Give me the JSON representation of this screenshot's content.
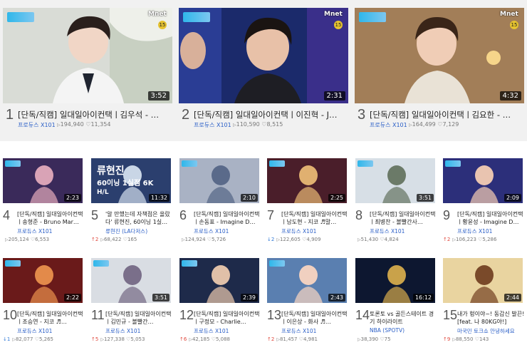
{
  "top": [
    {
      "rank": "1",
      "title": "[단독/직캠] 일대일아이컨택ㅣ김우석 - …",
      "channel": "프로듀스 X101",
      "views": "194,940",
      "likes": "11,354",
      "duration": "3:52",
      "channel_logo": "Mnet"
    },
    {
      "rank": "2",
      "title": "[단독/직캠] 일대일아이컨택ㅣ이진혁 - J…",
      "channel": "프로듀스 X101",
      "views": "110,590",
      "likes": "8,515",
      "duration": "2:31",
      "channel_logo": "Mnet"
    },
    {
      "rank": "3",
      "title": "[단독/직캠] 일대일아이컨택ㅣ김요한 - …",
      "channel": "프로듀스 X101",
      "views": "164,499",
      "likes": "7,129",
      "duration": "4:32",
      "channel_logo": "Mnet"
    }
  ],
  "row1": [
    {
      "rank": "4",
      "title": "[단독/직캠] 일대일아이컨택ㅣ송형준 - Bruno Mar…",
      "channel": "프로듀스 X101",
      "change": "",
      "change_dir": "",
      "views": "205,124",
      "likes": "6,553",
      "duration": "2:23"
    },
    {
      "rank": "5",
      "title": "'알 만했는데 자책점은 올랐다' 류현진, 60이닝 1실…",
      "channel": "류현진 (LA다저스)",
      "change": "↑2",
      "change_dir": "up",
      "views": "68,422",
      "likes": "165",
      "duration": "11:32",
      "overlay_text": "류현진",
      "overlay_sub": "60이닝 1실점 6K",
      "overlay_sub2": "H/L"
    },
    {
      "rank": "6",
      "title": "[단독/직캠] 일대일아이컨택ㅣ손동표 - Imagine D…",
      "channel": "프로듀스 X101",
      "change": "",
      "change_dir": "",
      "views": "124,924",
      "likes": "5,726",
      "duration": "2:10"
    },
    {
      "rank": "7",
      "title": "[단독/직캠] 일대일아이컨택ㅣ남도현 - 지코 ♬말…",
      "channel": "프로듀스 X101",
      "change": "↓2",
      "change_dir": "down",
      "views": "122,605",
      "likes": "4,909",
      "duration": "2:25"
    },
    {
      "rank": "8",
      "title": "[단독/직캠] 일대일아이컨택ㅣ최병찬 - 볼빨간사…",
      "channel": "프로듀스 X101",
      "change": "",
      "change_dir": "",
      "views": "51,430",
      "likes": "4,824",
      "duration": "3:51"
    },
    {
      "rank": "9",
      "title": "[단독/직캠] 일대일아이컨택ㅣ황윤성 - Imagine D…",
      "channel": "프로듀스 X101",
      "change": "↑2",
      "change_dir": "up",
      "views": "106,223",
      "likes": "5,286",
      "duration": "2:09"
    }
  ],
  "row2": [
    {
      "rank": "10",
      "title": "[단독/직캠] 일대일아이컨택ㅣ조승연 - 지코 ♬…",
      "channel": "프로듀스 X101",
      "change": "↓1",
      "change_dir": "down",
      "views": "82,077",
      "likes": "5,265",
      "duration": "2:22"
    },
    {
      "rank": "11",
      "title": "[단독/직캠] 일대일아이컨택ㅣ김민규 - 볼빨간…",
      "channel": "프로듀스 X101",
      "change": "↑5",
      "change_dir": "up",
      "views": "127,338",
      "likes": "5,053",
      "duration": "3:51"
    },
    {
      "rank": "12",
      "title": "[단독/직캠] 일대일아이컨택ㅣ구정모 - Charlie…",
      "channel": "프로듀스 X101",
      "change": "↑6",
      "change_dir": "up",
      "views": "42,185",
      "likes": "5,088",
      "duration": "2:39"
    },
    {
      "rank": "13",
      "title": "[단독/직캠] 일대일아이컨택ㅣ이은상 - 화사 ♬…",
      "channel": "프로듀스 X101",
      "change": "↑2",
      "change_dir": "up",
      "views": "81,457",
      "likes": "4,981",
      "duration": "2:43"
    },
    {
      "rank": "14",
      "title": "토론토 vs 골든스테이트 경기 하이라이트",
      "channel": "NBA (SPOTV)",
      "change": "",
      "change_dir": "",
      "views": "38,390",
      "likes": "75",
      "duration": "16:12"
    },
    {
      "rank": "15",
      "title": "내가 헝이야~! 동갑신 발끈! [feat. 나 80KG야!]",
      "channel": "마국민 토크쇼 안녕하세요",
      "change": "↑9",
      "change_dir": "up",
      "views": "88,550",
      "likes": "143",
      "duration": "2:44"
    }
  ],
  "colors": {
    "channel": "#2b5fc7",
    "up": "#e0473c",
    "down": "#2f78d6",
    "top_band": "#f1f1f1"
  },
  "icons": {
    "views": "play-icon",
    "likes": "heart-icon"
  }
}
